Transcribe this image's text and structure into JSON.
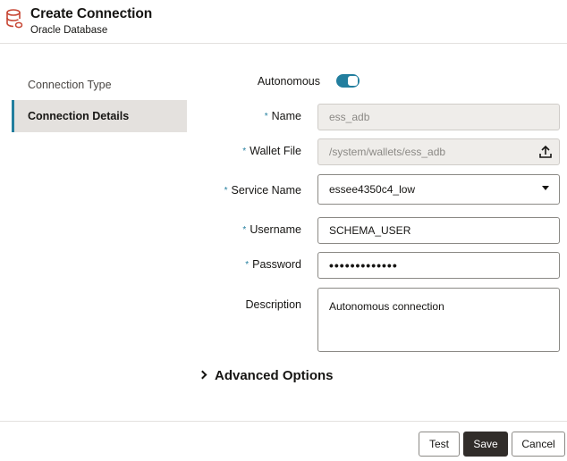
{
  "header": {
    "title": "Create Connection",
    "subtitle": "Oracle Database",
    "icon": "database-icon",
    "icon_color": "#c74634"
  },
  "sidebar": {
    "items": [
      {
        "label": "Connection Type",
        "active": false
      },
      {
        "label": "Connection Details",
        "active": true
      }
    ]
  },
  "form": {
    "autonomous": {
      "label": "Autonomous",
      "on": true
    },
    "name": {
      "label": "Name",
      "value": "ess_adb"
    },
    "wallet_file": {
      "label": "Wallet File",
      "value": "/system/wallets/ess_adb"
    },
    "service_name": {
      "label": "Service Name",
      "value": "essee4350c4_low"
    },
    "username": {
      "label": "Username",
      "value": "SCHEMA_USER"
    },
    "password": {
      "label": "Password",
      "value": "•••••••••••••"
    },
    "description": {
      "label": "Description",
      "value": "Autonomous connection"
    },
    "required_mark": "*"
  },
  "advanced": {
    "label": "Advanced Options"
  },
  "footer": {
    "test_label": "Test",
    "save_label": "Save",
    "cancel_label": "Cancel"
  },
  "colors": {
    "accent": "#227e9e",
    "primary_button": "#312d2a",
    "brand_red": "#c74634"
  }
}
